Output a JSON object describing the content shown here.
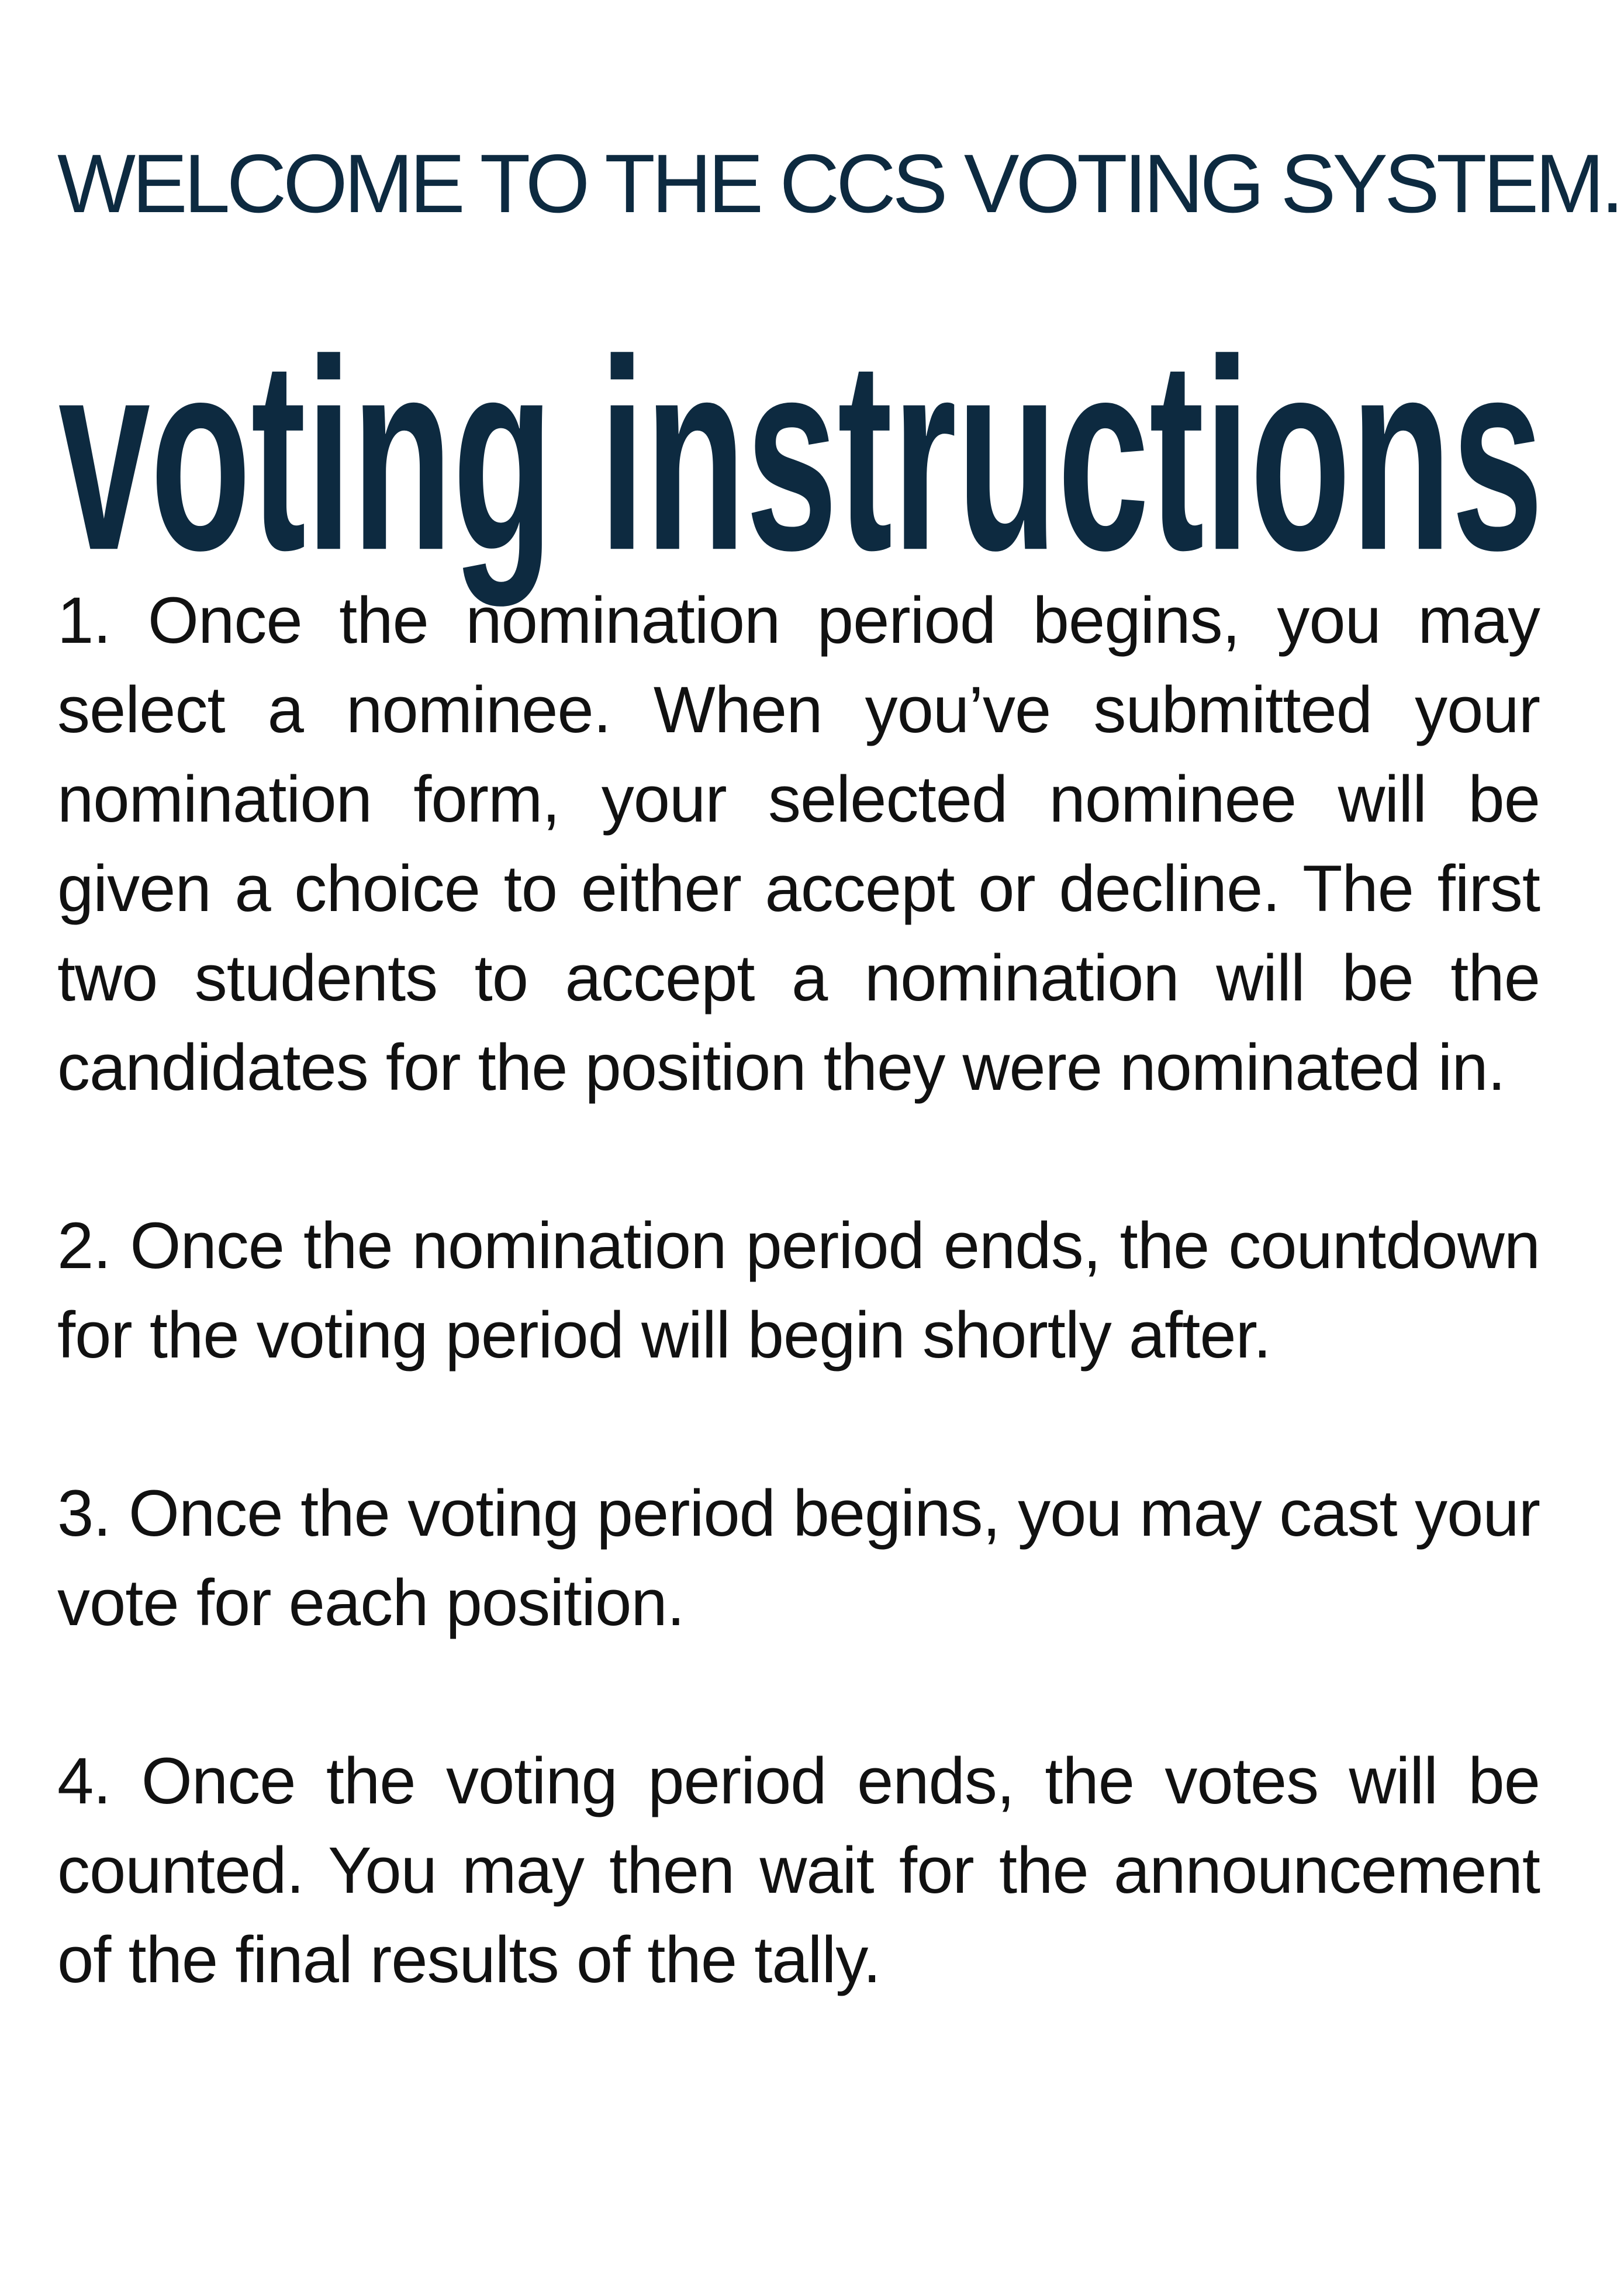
{
  "header": {
    "welcome": "WELCOME TO THE CCS VOTING SYSTEM.",
    "title": "voting instructions"
  },
  "instructions": [
    "1. Once the nomination period begins, you may select a nominee. When you’ve submitted your nomination form, your selected nominee will be given a choice to either accept or decline. The first two students to accept a nomination will be the candidates for the position they were nominated in.",
    "2. Once the nomination period ends, the countdown for the voting period will begin shortly after.",
    "3. Once the voting period begins, you may cast your vote for each position.",
    "4. Once the voting period ends, the votes will be counted. You may then wait for the announcement of the final results of the tally."
  ],
  "colors": {
    "heading": "#0d2a40",
    "body_text": "#111111",
    "background": "#ffffff"
  }
}
